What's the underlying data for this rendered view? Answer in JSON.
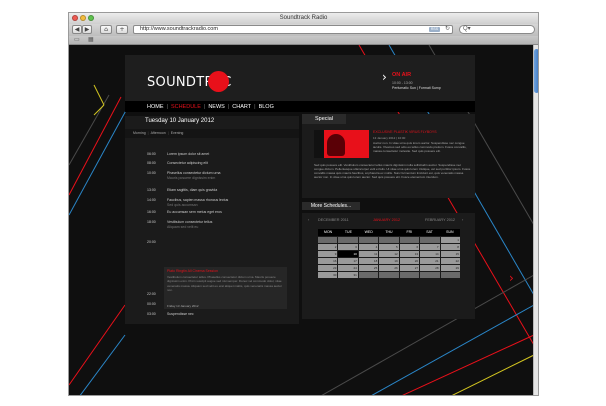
{
  "browser": {
    "title": "Soundtrack Radio",
    "url": "http://www.soundtrackradio.com",
    "rss_label": "RSS",
    "back_icon": "◀",
    "forward_icon": "▶",
    "home_icon": "⌂",
    "add_icon": "+",
    "reload_icon": "↻",
    "search_icon": "Q▾",
    "bookmarks_icon": "▭",
    "grid_icon": "▦"
  },
  "site": {
    "logo_text": "SOUNDTRAC",
    "accent_color": "#e8101a",
    "on_air": {
      "arrow": "›",
      "label": "ON AIR",
      "time": "10:00 - 13:00",
      "show": "Perfumatic Sun | Formati Sump"
    },
    "nav": [
      "HOME",
      "SCHEDULE",
      "NEWS",
      "CHART",
      "BLOG"
    ],
    "nav_separator": "|",
    "active_nav": "SCHEDULE"
  },
  "schedule": {
    "title": "Tuesday 10 January 2012",
    "tabs": [
      "Morning",
      "Afternoon",
      "Evening"
    ],
    "tab_separator": "|",
    "rows": [
      {
        "time": "06:00",
        "desc": "Lorem ipsum dolor sit amet",
        "sub": ""
      },
      {
        "time": "08:00",
        "desc": "Consectetur adipiscing elit",
        "sub": ""
      },
      {
        "time": "10:00",
        "desc": "Phasellus consectetur dictum urna",
        "sub": "Mauris posuere dignissim enim"
      },
      {
        "time": "13:00",
        "desc": "Etiam sagittis, diam quis gravida",
        "sub": ""
      },
      {
        "time": "14:00",
        "desc": "Faucibus, sapien massa rhoncus lectus",
        "sub": "Sed quis accumsan"
      },
      {
        "time": "16:00",
        "desc": "Eu accumsan sem metus eget eros",
        "sub": ""
      },
      {
        "time": "18:00",
        "desc": "Vestibulum consectetur tellus",
        "sub": "Aliquam sed velit eu"
      },
      {
        "time": "20:00",
        "desc": "",
        "sub": ""
      },
      {
        "time": "22:00",
        "desc": "Nulla fermentum tincidunt est",
        "sub": "Condimentum pretium"
      },
      {
        "time": "00:00",
        "desc": "Quis venenatis massa auctor non",
        "sub": ""
      },
      {
        "time": "03:00",
        "desc": "Suspendisse nec",
        "sub": ""
      }
    ],
    "feature": {
      "title": "Plato Ringtin All Cinema Session",
      "body": "Vestibulum consectetur tellus. Phasellus consectetur dictum urna. Mauris posuere dignissim enim. Proin suscipit augue sed nisi semper. Donec vel commodo dolor, vitae venenatis massa. Aliquam sed velit eu erat aliquet mattis, quis venenatis massa auctor non.",
      "date": "Friday 13 January 2012"
    }
  },
  "special": {
    "title": "Special",
    "headline": "EXCLUSIVE PLASTIK VIRUS FLYBOYS",
    "date": "13 January 2012 | 10:00",
    "text": "Auctor non. In vitae urna quis lorem auctor. Suspendisse nec congue iaculis. Vivamus sed odio eu tellus commodo pretium. Fusce convallis, massa consectetur molestie. Sed quis posuere elit.",
    "text2": "Sed quis posuere elit. Vestibulum consectetur tellus mauris dignissim nulla sollicitudin auctor. Suspendisse nec congue dictum. Pellentesque ullamcorper velit et felis. Ut vitae urna quis lorem tristique, vel sed porttitor ipsum. Fusce convallis massa quis mauris faucibus, at pharetra ex mollis. Nunc fermentum tincidunt est, quis venenatis massa auctor non. In vitae urna quis lorem auctor. Sed quis posuere elit. Fusce elementum interdum."
  },
  "more_schedules": {
    "title": "More Schedules...",
    "prev_arrow": "‹",
    "next_arrow": "›",
    "prev_month": "DECEMBER 2011",
    "current_month": "JANUARY 2012",
    "next_month": "FEBRUARY 2012",
    "weekdays": [
      "MON",
      "TUE",
      "WED",
      "THU",
      "FRI",
      "SAT",
      "SUN"
    ],
    "today": "10",
    "weeks": [
      [
        "",
        "",
        "",
        "",
        "",
        "",
        "1"
      ],
      [
        "2",
        "3",
        "4",
        "5",
        "6",
        "7",
        "8"
      ],
      [
        "9",
        "10",
        "11",
        "12",
        "13",
        "14",
        "15"
      ],
      [
        "16",
        "17",
        "18",
        "19",
        "20",
        "21",
        "22"
      ],
      [
        "23",
        "24",
        "25",
        "26",
        "27",
        "28",
        "29"
      ],
      [
        "30",
        "31",
        "",
        "",
        "",
        "",
        ""
      ]
    ]
  },
  "side_arrow": "›"
}
